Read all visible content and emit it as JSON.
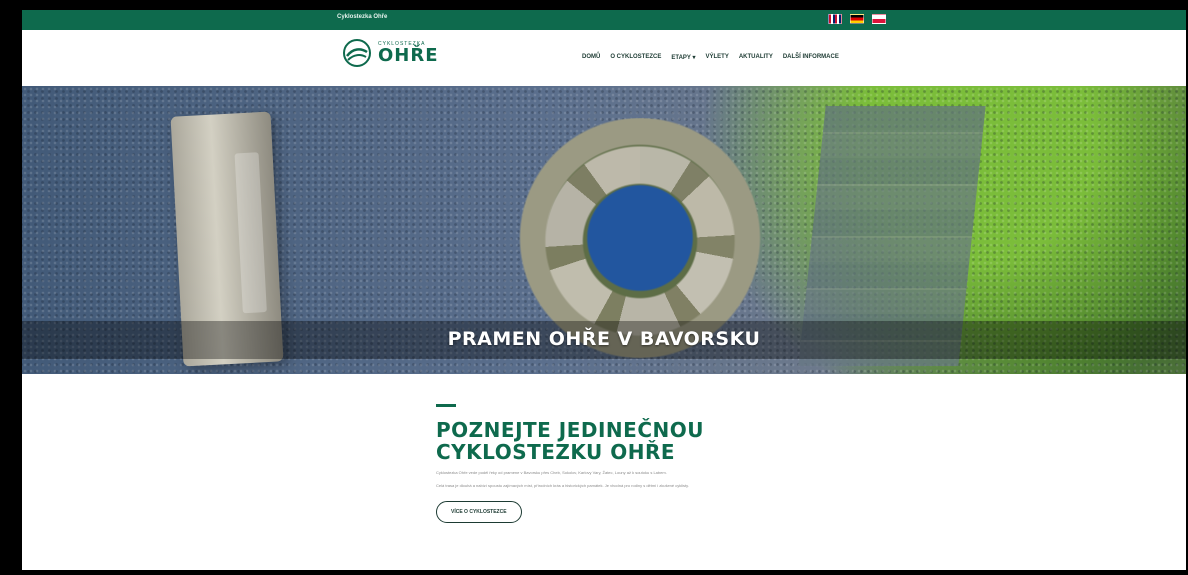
{
  "topbar": {
    "link_text": "Cyklostezka Ohře",
    "flags": [
      "flag-en",
      "flag-de",
      "flag-pl"
    ]
  },
  "brand": {
    "small": "CYKLOSTEZKA",
    "big": "OHŘE",
    "color": "#0e6a4d"
  },
  "menu": {
    "items": [
      {
        "label": "DOMŮ"
      },
      {
        "label": "O CYKLOSTEZCE"
      },
      {
        "label": "ETAPY ▾"
      },
      {
        "label": "VÝLETY"
      },
      {
        "label": "AKTUALITY"
      },
      {
        "label": "DALŠÍ INFORMACE"
      }
    ]
  },
  "hero": {
    "title": "PRAMEN OHŘE V BAVORSKU"
  },
  "content": {
    "heading_line1": "POZNEJTE JEDINEČNOU",
    "heading_line2": "CYKLOSTEZKU OHŘE",
    "paragraph1": "Cyklostezka Ohře vede podél řeky od pramene v Bavorsku přes Cheb, Sokolov, Karlovy Vary, Žatec, Louny až k soutoku s Labem.",
    "paragraph2": "Celá trasa je dlouhá a nabízí spoustu zajímavých míst, přírodních krás a historických památek. Je vhodná pro rodiny s dětmi i zkušené cyklisty.",
    "cta_label": "VÍCE O CYKLOSTEZCE"
  }
}
